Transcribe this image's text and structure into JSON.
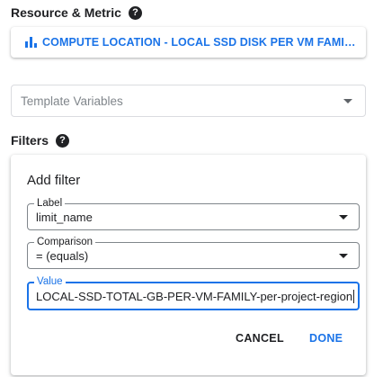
{
  "resource_section": {
    "title": "Resource & Metric",
    "help_icon": "help-circle-icon",
    "selected_metric": "COMPUTE LOCATION - LOCAL SSD DISK PER VM FAMILY (…",
    "metric_icon": "bar-chart-icon"
  },
  "template_variables": {
    "placeholder": "Template Variables"
  },
  "filters_section": {
    "title": "Filters",
    "help_icon": "help-circle-icon"
  },
  "add_filter": {
    "heading": "Add filter",
    "label_field": {
      "label": "Label",
      "value": "limit_name"
    },
    "comparison_field": {
      "label": "Comparison",
      "value": "= (equals)"
    },
    "value_field": {
      "label": "Value",
      "value": "LOCAL-SSD-TOTAL-GB-PER-VM-FAMILY-per-project-region"
    },
    "cancel_label": "CANCEL",
    "done_label": "DONE"
  },
  "colors": {
    "accent": "#1a73e8",
    "text": "#202124",
    "placeholder": "#80868b"
  }
}
